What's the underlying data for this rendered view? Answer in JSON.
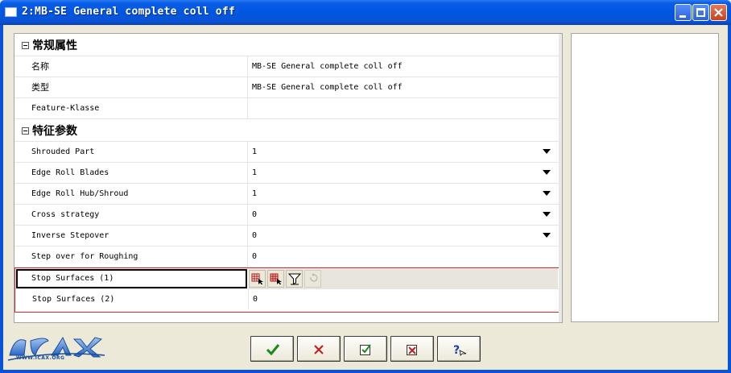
{
  "window": {
    "title": "2:MB-SE General complete coll off"
  },
  "categories": {
    "general": {
      "label": "常规属性"
    },
    "feature_params": {
      "label": "特征参数"
    }
  },
  "general_props": [
    {
      "name": "名称",
      "value": "MB-SE General complete coll off"
    },
    {
      "name": "类型",
      "value": "MB-SE General complete coll off"
    },
    {
      "name": "Feature-Klasse",
      "value": ""
    }
  ],
  "feature_props": [
    {
      "name": "Shrouded Part",
      "value": "1",
      "dropdown": true
    },
    {
      "name": "Edge Roll Blades",
      "value": "1",
      "dropdown": true
    },
    {
      "name": "Edge Roll Hub/Shroud",
      "value": "1",
      "dropdown": true
    },
    {
      "name": "Cross strategy",
      "value": "0",
      "dropdown": true
    },
    {
      "name": "Inverse Stepover",
      "value": "0",
      "dropdown": true
    },
    {
      "name": "Step over for Roughing",
      "value": "0",
      "dropdown": false
    }
  ],
  "selected_row": {
    "name": "Stop Surfaces (1)",
    "count": "1",
    "checked": true,
    "tools": [
      "select-surfaces-icon",
      "select-surfaces-add-icon",
      "filter-icon",
      "undo-icon"
    ]
  },
  "next_row": {
    "name": "Stop Surfaces (2)",
    "value": "0"
  },
  "logo": {
    "subtext": "WWW.ICAX.ORG",
    "mark": "ICAX"
  },
  "buttons": [
    "ok-icon",
    "cancel-icon",
    "apply-icon",
    "reset-icon",
    "help-icon"
  ],
  "colors": {
    "title_bar": "#0056e0",
    "selection_outline": "#d52a2a",
    "ok_green": "#1a8a1a",
    "cancel_red": "#c81818"
  }
}
